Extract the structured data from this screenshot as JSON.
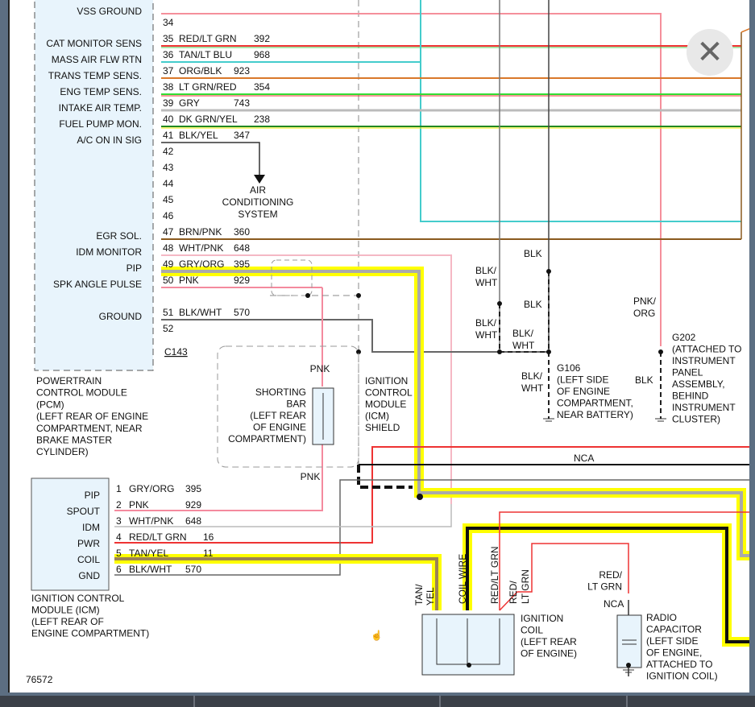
{
  "pcm": {
    "pins": [
      {
        "label": "VSS GROUND",
        "num": "",
        "color": "",
        "circuit": ""
      },
      {
        "label": "",
        "num": "34",
        "color": "",
        "circuit": ""
      },
      {
        "label": "CAT MONITOR SENS",
        "num": "35",
        "color": "RED/LT GRN",
        "circuit": "392"
      },
      {
        "label": "MASS AIR FLW RTN",
        "num": "36",
        "color": "TAN/LT BLU",
        "circuit": "968"
      },
      {
        "label": "TRANS TEMP SENS.",
        "num": "37",
        "color": "ORG/BLK",
        "circuit": "923"
      },
      {
        "label": "ENG TEMP SENS.",
        "num": "38",
        "color": "LT GRN/RED",
        "circuit": "354"
      },
      {
        "label": "INTAKE AIR TEMP.",
        "num": "39",
        "color": "GRY",
        "circuit": "743"
      },
      {
        "label": "FUEL PUMP MON.",
        "num": "40",
        "color": "DK GRN/YEL",
        "circuit": "238"
      },
      {
        "label": "A/C ON IN SIG",
        "num": "41",
        "color": "BLK/YEL",
        "circuit": "347"
      },
      {
        "label": "",
        "num": "42",
        "color": "",
        "circuit": ""
      },
      {
        "label": "",
        "num": "43",
        "color": "",
        "circuit": ""
      },
      {
        "label": "",
        "num": "44",
        "color": "",
        "circuit": ""
      },
      {
        "label": "",
        "num": "45",
        "color": "",
        "circuit": ""
      },
      {
        "label": "",
        "num": "46",
        "color": "",
        "circuit": ""
      },
      {
        "label": "EGR SOL.",
        "num": "47",
        "color": "BRN/PNK",
        "circuit": "360"
      },
      {
        "label": "IDM MONITOR",
        "num": "48",
        "color": "WHT/PNK",
        "circuit": "648"
      },
      {
        "label": "PIP",
        "num": "49",
        "color": "GRY/ORG",
        "circuit": "395"
      },
      {
        "label": "SPK ANGLE PULSE",
        "num": "50",
        "color": "PNK",
        "circuit": "929"
      },
      {
        "label": "",
        "num": "",
        "color": "",
        "circuit": ""
      },
      {
        "label": "GROUND",
        "num": "51",
        "color": "BLK/WHT",
        "circuit": "570"
      },
      {
        "label": "",
        "num": "52",
        "color": "",
        "circuit": ""
      }
    ],
    "connector": "C143",
    "description": [
      "POWERTRAIN",
      "CONTROL MODULE",
      "(PCM)",
      "(LEFT REAR OF ENGINE",
      "COMPARTMENT, NEAR",
      "BRAKE MASTER",
      "CYLINDER)"
    ]
  },
  "ac_system": [
    "AIR",
    "CONDITIONING",
    "SYSTEM"
  ],
  "icm": {
    "pins": [
      {
        "label": "PIP",
        "num": "1",
        "color": "GRY/ORG",
        "circuit": "395"
      },
      {
        "label": "SPOUT",
        "num": "2",
        "color": "PNK",
        "circuit": "929"
      },
      {
        "label": "IDM",
        "num": "3",
        "color": "WHT/PNK",
        "circuit": "648"
      },
      {
        "label": "PWR",
        "num": "4",
        "color": "RED/LT GRN",
        "circuit": "16"
      },
      {
        "label": "COIL",
        "num": "5",
        "color": "TAN/YEL",
        "circuit": "11"
      },
      {
        "label": "GND",
        "num": "6",
        "color": "BLK/WHT",
        "circuit": "570"
      }
    ],
    "description": [
      "IGNITION CONTROL",
      "MODULE (ICM)",
      "(LEFT REAR OF",
      "ENGINE COMPARTMENT)"
    ]
  },
  "shorting_bar": {
    "label": [
      "SHORTING",
      "BAR",
      "(LEFT REAR",
      "OF ENGINE",
      "COMPARTMENT)"
    ],
    "top_wire": "PNK",
    "bottom_wire": "PNK"
  },
  "icm_shield": [
    "IGNITION",
    "CONTROL",
    "MODULE",
    "(ICM)",
    "SHIELD"
  ],
  "ground_labels": {
    "blk_wht_1": [
      "BLK/",
      "WHT"
    ],
    "blk_1": "BLK",
    "blk_2": "BLK",
    "blk_wht_2": [
      "BLK/",
      "WHT"
    ],
    "blk_wht_3": [
      "BLK/",
      "WHT"
    ],
    "blk_wht_4": [
      "BLK/",
      "WHT"
    ],
    "pnk_org": [
      "PNK/",
      "ORG"
    ],
    "blk_3": "BLK"
  },
  "g106": [
    "G106",
    "(LEFT SIDE",
    "OF ENGINE",
    "COMPARTMENT,",
    "NEAR BATTERY)"
  ],
  "g202": [
    "G202",
    "(ATTACHED TO",
    "INSTRUMENT",
    "PANEL",
    "ASSEMBLY,",
    "BEHIND",
    "INSTRUMENT",
    "CLUSTER)"
  ],
  "nca_label": "NCA",
  "coil": {
    "wire_labels": {
      "tan_yel": [
        "TAN/",
        "YEL"
      ],
      "coil_wire": "COIL WIRE",
      "red_lt_grn_1": "RED/LT GRN",
      "red_lt_grn_2": [
        "RED/",
        "LT GRN"
      ]
    },
    "label": [
      "IGNITION",
      "COIL",
      "(LEFT REAR",
      "OF ENGINE)"
    ]
  },
  "capacitor": {
    "wire_label": [
      "RED/",
      "LT GRN"
    ],
    "nca": "NCA",
    "label": [
      "RADIO",
      "CAPACITOR",
      "(LEFT SIDE",
      "OF ENGINE,",
      "ATTACHED TO",
      "IGNITION COIL)"
    ]
  },
  "figure_number": "76572",
  "close_icon": "close-icon",
  "colors": {
    "pcm_fill": "#e8f4fc",
    "highlight": "#ffff00",
    "frame": "#5c6e82"
  }
}
